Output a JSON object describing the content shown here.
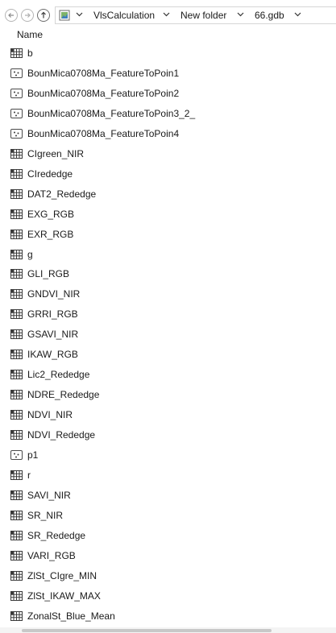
{
  "address": {
    "crumbs": [
      "VlsCalculation",
      "New folder",
      "66.gdb"
    ]
  },
  "columns": {
    "name": "Name"
  },
  "items": [
    {
      "name": "b",
      "type": "raster"
    },
    {
      "name": "BounMica0708Ma_FeatureToPoin1",
      "type": "point"
    },
    {
      "name": "BounMica0708Ma_FeatureToPoin2",
      "type": "point"
    },
    {
      "name": "BounMica0708Ma_FeatureToPoin3_2_",
      "type": "point"
    },
    {
      "name": "BounMica0708Ma_FeatureToPoin4",
      "type": "point"
    },
    {
      "name": "CIgreen_NIR",
      "type": "raster"
    },
    {
      "name": "CIrededge",
      "type": "raster"
    },
    {
      "name": "DAT2_Rededge",
      "type": "raster"
    },
    {
      "name": "EXG_RGB",
      "type": "raster"
    },
    {
      "name": "EXR_RGB",
      "type": "raster"
    },
    {
      "name": "g",
      "type": "raster"
    },
    {
      "name": "GLI_RGB",
      "type": "raster"
    },
    {
      "name": "GNDVI_NIR",
      "type": "raster"
    },
    {
      "name": "GRRI_RGB",
      "type": "raster"
    },
    {
      "name": "GSAVI_NIR",
      "type": "raster"
    },
    {
      "name": "IKAW_RGB",
      "type": "raster"
    },
    {
      "name": "Lic2_Rededge",
      "type": "raster"
    },
    {
      "name": "NDRE_Rededge",
      "type": "raster"
    },
    {
      "name": "NDVI_NIR",
      "type": "raster"
    },
    {
      "name": "NDVI_Rededge",
      "type": "raster"
    },
    {
      "name": "p1",
      "type": "point"
    },
    {
      "name": "r",
      "type": "raster"
    },
    {
      "name": "SAVI_NIR",
      "type": "raster"
    },
    {
      "name": "SR_NIR",
      "type": "raster"
    },
    {
      "name": "SR_Rededge",
      "type": "raster"
    },
    {
      "name": "VARI_RGB",
      "type": "raster"
    },
    {
      "name": "ZlSt_CIgre_MIN",
      "type": "raster"
    },
    {
      "name": "ZlSt_IKAW_MAX",
      "type": "raster"
    },
    {
      "name": "ZonalSt_Blue_Mean",
      "type": "raster"
    }
  ]
}
